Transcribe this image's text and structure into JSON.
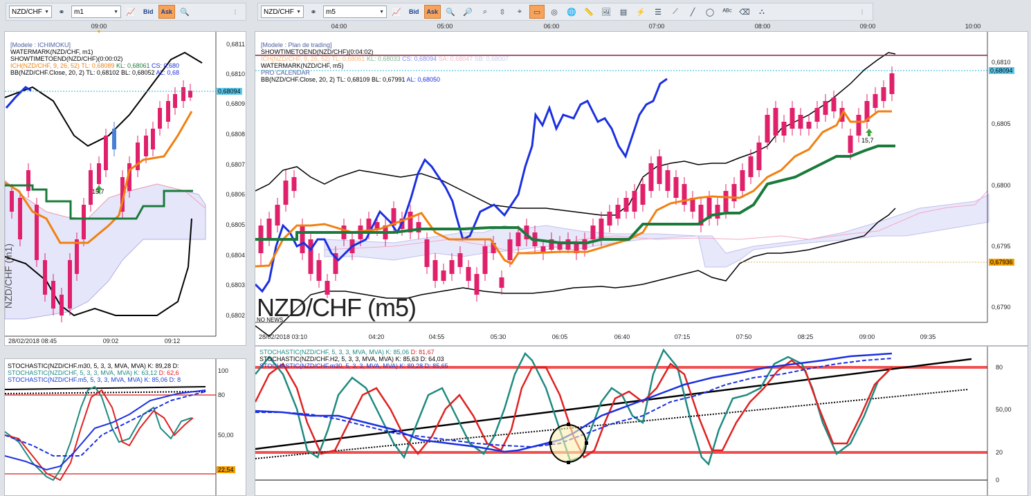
{
  "left_toolbar": {
    "symbol": "NZD/CHF",
    "link_icon": "link-icon",
    "timeframe": "m1",
    "bid": "Bid",
    "ask": "Ask"
  },
  "right_toolbar": {
    "symbol": "NZD/CHF",
    "link_icon": "link-icon",
    "timeframe": "m5",
    "bid": "Bid",
    "ask": "Ask"
  },
  "left_chart": {
    "top_time": "09:00",
    "legend": [
      {
        "text": "[Modele : ICHIMOKU]",
        "color": "#4a5fa0"
      },
      {
        "text": "WATERMARK(NZD/CHF, m1)",
        "color": "#000000"
      },
      {
        "text": "SHOWTIMETOEND(NZD/CHF)(0:00:02)",
        "color": "#000000"
      }
    ],
    "ich_line": {
      "label": "ICH(NZD/CHF, 9, 26, 52)",
      "tl": "TL: 0,68089",
      "kl": "KL: 0,68061",
      "cs": "CS: 0,680"
    },
    "bb_line": {
      "label": "BB(NZD/CHF.Close, 20, 2)",
      "tl": "TL: 0,68102",
      "bl": "BL: 0,68052",
      "al": "AL: 0,68"
    },
    "price_axis": [
      "0,6811",
      "0,6810",
      "0,6809",
      "0,6808",
      "0,6807",
      "0,6806",
      "0,6805",
      "0,6804",
      "0,6803",
      "0,6802"
    ],
    "price_tag": "0,68094",
    "time_axis": [
      "28/02/2018 08:45",
      "09:02",
      "09:12"
    ],
    "arrow_label": "15,7",
    "watermark": "NZD/CHF (m1)"
  },
  "right_chart": {
    "top_times": [
      "04:00",
      "05:00",
      "06:00",
      "07:00",
      "08:00",
      "09:00",
      "10:00"
    ],
    "legend": [
      {
        "text": "[Modele : Plan de trading]",
        "color": "#4a5fa0"
      },
      {
        "text": "SHOWTIMETOEND(NZD/CHF)(0:04:02)",
        "color": "#000000"
      },
      {
        "text": "WATERMARK(NZD/CHF, m5)",
        "color": "#000000"
      },
      {
        "text": "PRO CALENDAR",
        "color": "#4a5fa0"
      }
    ],
    "ich_line": {
      "label": "ICH(NZD/CHF, 9, 26, 52)",
      "tl": "TL: 0,68061",
      "kl": "KL: 0,68033",
      "cs": "CS: 0,68094",
      "sa": "SA: 0,68047",
      "sb": "SB: 0,68007"
    },
    "bb_line": {
      "label": "BB(NZD/CHF.Close, 20, 2)",
      "tl": "TL: 0,68109",
      "bl": "BL: 0,67991",
      "al": "AL: 0,68050"
    },
    "price_axis": [
      "0,6810",
      "0,6805",
      "0,6800",
      "0,6795",
      "0,6790"
    ],
    "price_tag": "0,68094",
    "price_tag2": "0,67936",
    "time_axis": [
      "28/02/2018 03:10",
      "04:20",
      "04:55",
      "05:30",
      "06:05",
      "06:40",
      "07:15",
      "07:50",
      "08:25",
      "09:00",
      "09:35"
    ],
    "watermark": "NZD/CHF (m5)",
    "news": "NO NEWS",
    "arrow_label": "15,7"
  },
  "left_stoch": {
    "legend": [
      {
        "label": "STOCHASTIC(NZD/CHF.m30, 5, 3, 3, MVA, MVA)",
        "k": "K: 89,28",
        "d": "D:",
        "color": "#000000",
        "dcolor": "#000000"
      },
      {
        "label": "STOCHASTIC(NZD/CHF, 5, 3, 3, MVA, MVA)",
        "k": "K: 63,12",
        "d": "D: 62,6",
        "color": "#1e8a80",
        "dcolor": "#e02020"
      },
      {
        "label": "STOCHASTIC(NZD/CHF.m5, 5, 3, 3, MVA, MVA)",
        "k": "K: 85,06",
        "d": "D: 8",
        "color": "#1a3fd0",
        "dcolor": "#1a3fd0"
      }
    ],
    "axis": [
      "100",
      "80",
      "50,00"
    ],
    "tag": "22,54"
  },
  "right_stoch": {
    "legend": [
      {
        "label": "STOCHASTIC(NZD/CHF, 5, 3, 3, MVA, MVA)",
        "k": "K: 85,06",
        "d": "D: 81,67",
        "color": "#1e8a80",
        "dcolor": "#e02020"
      },
      {
        "label": "STOCHASTIC(NZD/CHF.H2, 5, 3, 3, MVA, MVA)",
        "k": "K: 85,63",
        "d": "D: 64,03",
        "color": "#000000",
        "dcolor": "#000000"
      },
      {
        "label": "STOCHASTIC(NZD/CHF.m30, 5, 3, 3, MVA, MVA)",
        "k": "K: 89,28",
        "d": "D: 85,65",
        "color": "#1a3fd0",
        "dcolor": "#1a3fd0"
      }
    ],
    "axis": [
      "80",
      "50,00",
      "20",
      "0"
    ]
  },
  "colors": {
    "bull": "#4a7fd6",
    "bear": "#e0206a",
    "orange": "#f08010",
    "green": "#1a7a3a",
    "blue": "#1a2fe0",
    "cyan_dot": "#20b8d8",
    "tag_bg": "#5cc8ea",
    "tag2_bg": "#f5a000"
  }
}
